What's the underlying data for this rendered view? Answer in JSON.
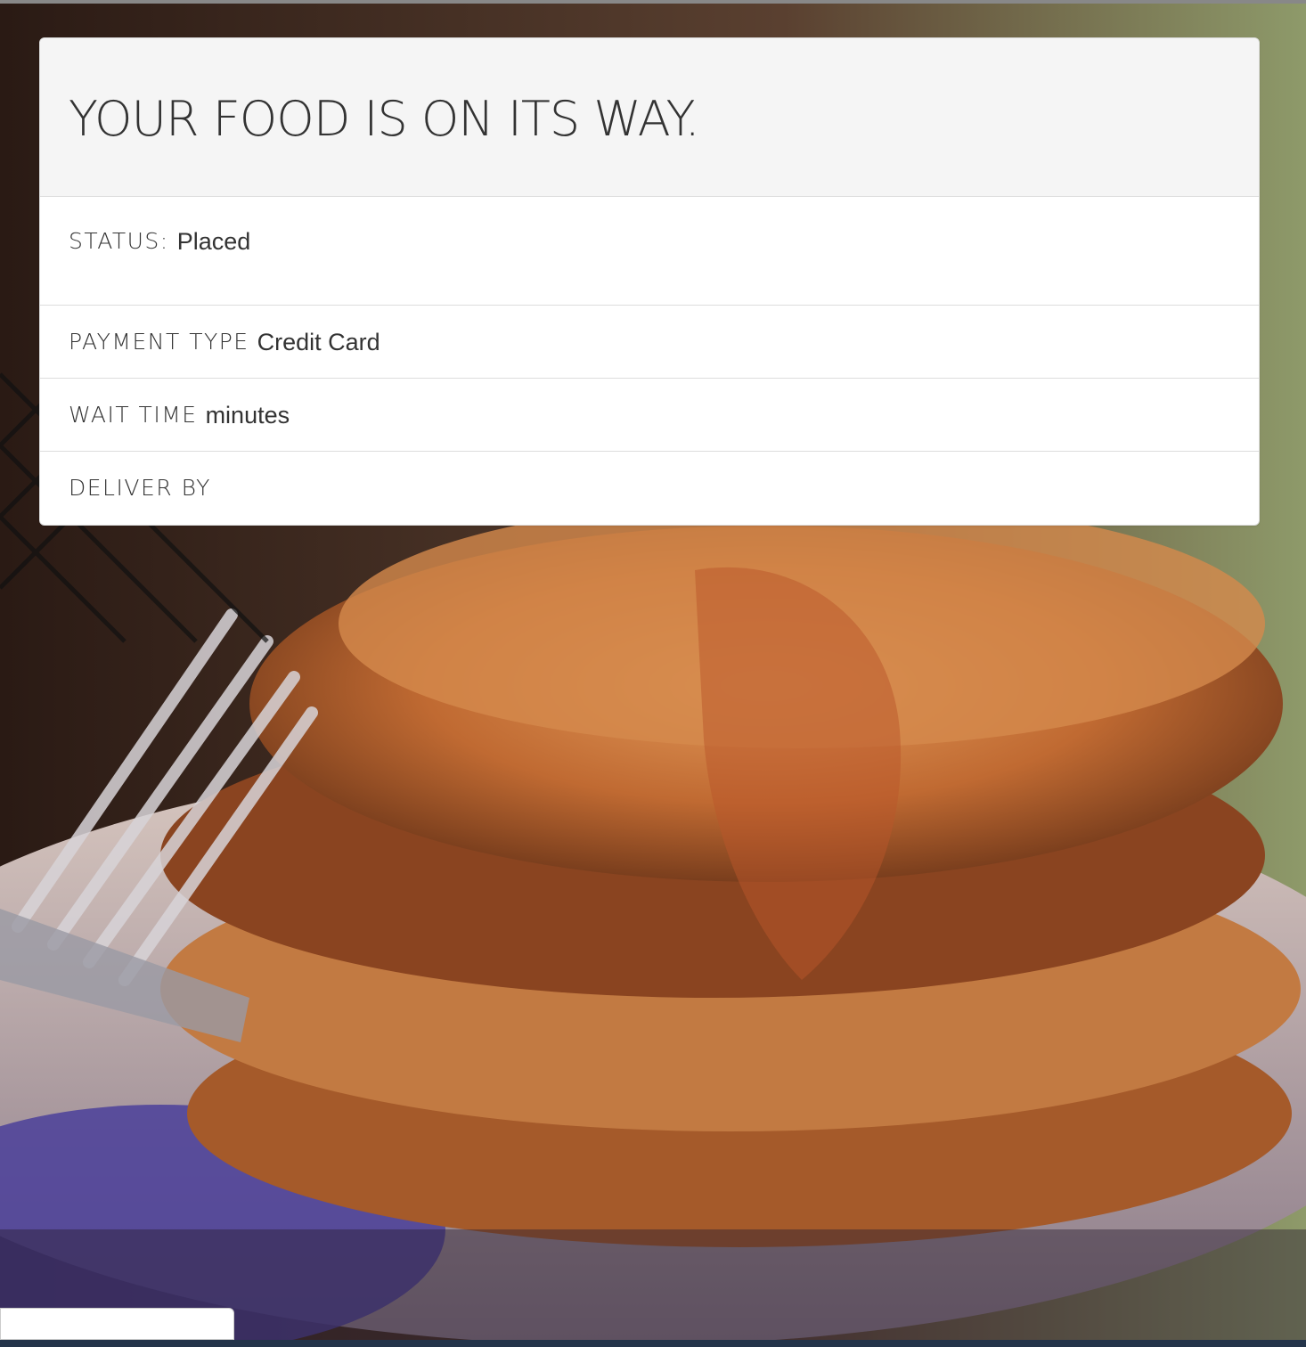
{
  "order": {
    "heading": "YOUR FOOD IS ON ITS WAY.",
    "status_label": "STATUS:",
    "status_value": "Placed",
    "payment_label": "PAYMENT TYPE",
    "payment_value": "Credit Card",
    "wait_label": "WAIT TIME",
    "wait_value": "minutes",
    "deliver_label": "DELIVER BY",
    "deliver_value": ""
  },
  "background": {
    "image_subject": "pancakes-photo"
  },
  "colors": {
    "heading_bg": "#f5f5f5",
    "panel_border": "#dddddd",
    "text": "#333333",
    "bottom_bar": "#24344a"
  }
}
